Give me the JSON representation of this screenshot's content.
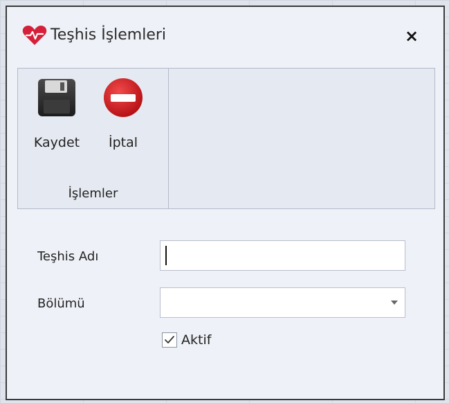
{
  "dialog": {
    "title": "Teşhis İşlemleri",
    "title_icon": "heart-icon",
    "close_label": "×"
  },
  "ribbon": {
    "group_label": "İşlemler",
    "buttons": [
      {
        "label": "Kaydet",
        "icon": "floppy-disk-icon"
      },
      {
        "label": "İptal",
        "icon": "stop-sign-icon"
      }
    ]
  },
  "form": {
    "diagnosis_name_label": "Teşhis Adı",
    "diagnosis_name_value": "",
    "department_label": "Bölümü",
    "department_value": "",
    "active_label": "Aktif",
    "active_checked": true
  },
  "colors": {
    "heart": "#d6203a",
    "cancel": "#c8141b",
    "floppy": "#2b2b2b"
  }
}
